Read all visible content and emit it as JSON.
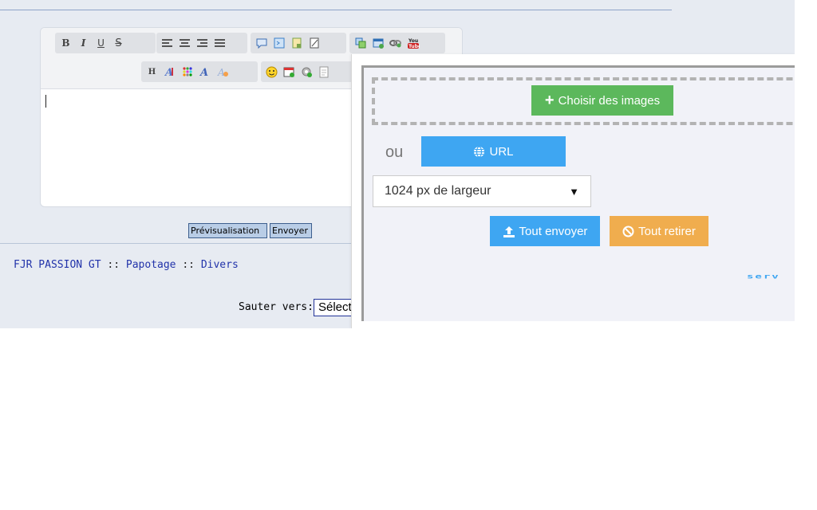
{
  "editor": {
    "toolbar_row1": [
      {
        "name": "bold-button",
        "glyph": "B"
      },
      {
        "name": "italic-button",
        "glyph": "I"
      },
      {
        "name": "underline-button",
        "glyph": "U"
      },
      {
        "name": "strikethrough-button",
        "glyph": "S"
      }
    ],
    "toolbar_row2_header": "H",
    "text_value": ""
  },
  "form": {
    "preview_label": "Prévisualisation",
    "send_label": "Envoyer"
  },
  "breadcrumb": {
    "site": "FJR PASSION GT",
    "sep": " :: ",
    "category": "Papotage",
    "forum": "Divers"
  },
  "jump": {
    "label": "Sauter vers:",
    "selected": "Sélectionner un forum"
  },
  "upload_panel": {
    "choose_label": "Choisir des images",
    "or_label": "ou",
    "url_label": "URL",
    "size_selected": "1024 px de largeur",
    "send_all_label": "Tout envoyer",
    "remove_all_label": "Tout retirer",
    "logo_text": "serv"
  },
  "colors": {
    "green": "#5cb85c",
    "blue": "#3ea6f2",
    "orange": "#f0ad4e",
    "link": "#2233aa"
  }
}
